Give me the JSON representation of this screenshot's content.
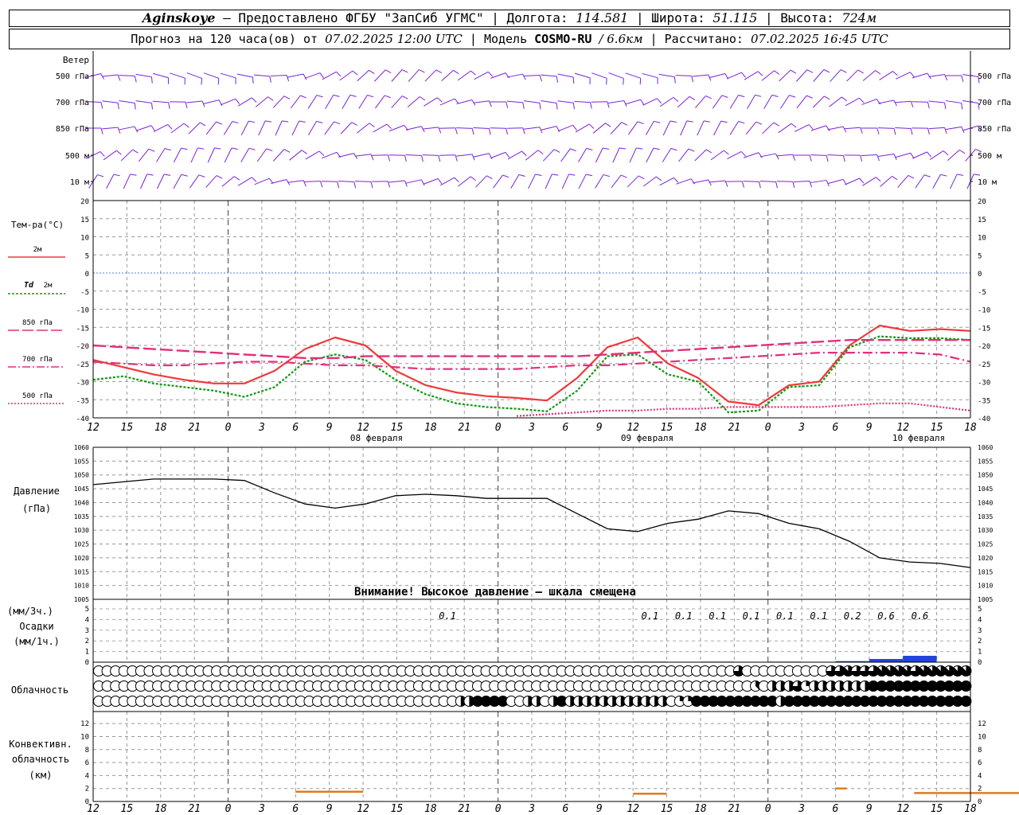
{
  "header": {
    "station": "Aginskoye",
    "provider": "– Предоставлено ФГБУ \"ЗапСиб УГМС\"",
    "lon_label": "Долгота:",
    "lon": "114.581",
    "lat_label": "Широта:",
    "lat": "51.115",
    "alt_label": "Высота:",
    "alt": "724м",
    "forecast_label": "Прогноз на 120 часа(ов) от",
    "forecast_start": "07.02.2025 12:00 UTC",
    "model_label": "Модель",
    "model": "COSMO-RU",
    "resolution": "/ 6.6км",
    "computed_label": "Рассчитано:",
    "computed": "07.02.2025 16:45 UTC"
  },
  "labels": {
    "wind_title": "Ветер",
    "wind_levels": [
      "500 гПа",
      "700 гПа",
      "850 гПа",
      "500 м",
      "10 м"
    ],
    "temp_title": "Тем-ра(°C)",
    "legend_2m": "2м",
    "legend_td": "Td",
    "legend_td_2m": "2м",
    "legend_850": "850 гПа",
    "legend_700": "700 гПа",
    "legend_500": "500 гПа",
    "pressure_title": "Давление",
    "pressure_unit": "(гПа)",
    "pressure_warning": "Внимание! Высокое давление – шкала смещена",
    "precip_unit3": "(мм/3ч.)",
    "precip_title": "Осадки",
    "precip_unit1": "(мм/1ч.)",
    "cloud_title": "Облачность",
    "conv_title1": "Конвективн.",
    "conv_title2": "облачность",
    "conv_unit": "(км)",
    "date_labels": [
      "08 февраля",
      "09 февраля",
      "10 февраля"
    ]
  },
  "chart_data": {
    "type": "line",
    "time_ticks": [
      "12",
      "15",
      "18",
      "21",
      "0",
      "3",
      "6",
      "9",
      "12",
      "15",
      "18",
      "21",
      "0",
      "3",
      "6",
      "9",
      "12",
      "15",
      "18",
      "21",
      "0",
      "3",
      "6",
      "9",
      "12",
      "15",
      "18"
    ],
    "temperature": {
      "ylim": [
        -40,
        20
      ],
      "yticks": [
        20,
        15,
        10,
        5,
        0,
        -5,
        -10,
        -15,
        -20,
        -25,
        -30,
        -35,
        -40
      ],
      "hours": [
        0,
        3,
        6,
        9,
        12,
        15,
        18,
        21,
        24,
        27,
        30,
        33,
        36,
        39,
        42,
        45,
        48,
        51,
        54,
        57,
        60,
        63,
        66,
        69,
        72,
        75,
        78
      ],
      "series": [
        {
          "name": "2м",
          "color": "#ee3a3a",
          "values": [
            -24,
            -26,
            -28,
            -29.5,
            -30.5,
            -30.5,
            -27,
            -21,
            -17.8,
            -20,
            -27,
            -31,
            -33,
            -34,
            -34.5,
            -35.2,
            -29,
            -20.5,
            -17.8,
            -25,
            -29,
            -35.5,
            -36.5,
            -31,
            -30,
            -20,
            -14.5,
            -16,
            -15.5,
            -16
          ]
        },
        {
          "name": "Td 2м",
          "color": "#119911",
          "values": [
            -29.5,
            -28.5,
            -30.5,
            -31.5,
            -32.5,
            -34.2,
            -31.5,
            -24.5,
            -22.5,
            -24,
            -29.5,
            -33.5,
            -36,
            -37,
            -37.5,
            -38.2,
            -32.5,
            -23,
            -22.5,
            -28,
            -30,
            -38.5,
            -38,
            -31.5,
            -31,
            -20.5,
            -17.5,
            -18,
            -18,
            -18.5
          ]
        },
        {
          "name": "850 гПа",
          "color": "#e0307a",
          "values": [
            -20,
            -20.5,
            -21,
            -21.5,
            -22,
            -22.5,
            -23,
            -23.5,
            -23.5,
            -23,
            -23,
            -23,
            -23,
            -23,
            -23,
            -23,
            -23,
            -22.5,
            -22,
            -21.5,
            -21,
            -20.5,
            -20,
            -19.5,
            -19,
            -18.5,
            -18.5,
            -18.5,
            -18.5,
            -18.5
          ]
        },
        {
          "name": "700 гПа",
          "color": "#e0307a",
          "values": [
            -24.5,
            -25,
            -25.5,
            -25.5,
            -25,
            -24.5,
            -24.5,
            -25,
            -25.5,
            -25.5,
            -26,
            -26.5,
            -26.5,
            -26.5,
            -26.5,
            -26,
            -25.5,
            -25.5,
            -25,
            -24.5,
            -24,
            -23.5,
            -23,
            -22.5,
            -22,
            -22,
            -22,
            -22,
            -22.5,
            -24.5
          ]
        },
        {
          "name": "500 гПа",
          "color": "#e0307a",
          "values": [
            null,
            null,
            null,
            null,
            null,
            null,
            null,
            null,
            null,
            null,
            null,
            null,
            null,
            null,
            -39.5,
            -39,
            -38.5,
            -38,
            -38,
            -37.5,
            -37.5,
            -37,
            -37,
            -37,
            -37,
            -36.5,
            -36,
            -36,
            -37,
            -38
          ]
        }
      ]
    },
    "pressure": {
      "ylim": [
        1005,
        1060
      ],
      "yticks": [
        1060,
        1055,
        1050,
        1045,
        1040,
        1035,
        1030,
        1025,
        1020,
        1015,
        1010,
        1005
      ],
      "values": [
        1046.5,
        1047.5,
        1048.5,
        1048.5,
        1048.5,
        1048,
        1043.5,
        1039.5,
        1038,
        1039.5,
        1042.5,
        1043,
        1042.5,
        1041.5,
        1041.5,
        1041.5,
        1036,
        1030.5,
        1029.5,
        1032.5,
        1034,
        1037,
        1036,
        1032.5,
        1030.5,
        1026,
        1020,
        1018.5,
        1018,
        1016.5
      ]
    },
    "precipitation": {
      "ylim": [
        0,
        5
      ],
      "yticks": [
        5,
        4,
        3,
        2,
        1,
        0
      ],
      "labels_3h": [
        {
          "hour": 43.5,
          "text": "0.1"
        },
        {
          "hour": 61.5,
          "text": "0.1"
        },
        {
          "hour": 64.5,
          "text": "0.1"
        },
        {
          "hour": 67.5,
          "text": "0.1"
        },
        {
          "hour": 70.5,
          "text": "0.1"
        },
        {
          "hour": 73.5,
          "text": "0.1"
        },
        {
          "hour": 76.5,
          "text": "0.1"
        },
        {
          "hour": 79.5,
          "text": "0.2"
        },
        {
          "hour": 82.5,
          "text": "0.6"
        },
        {
          "hour": 85.5,
          "text": "0.6"
        }
      ],
      "hourly": [
        {
          "hour": 42,
          "value": 0.05
        },
        {
          "hour": 60,
          "value": 0.05
        },
        {
          "hour": 66,
          "value": 0.05
        },
        {
          "hour": 72,
          "value": 0.05
        },
        {
          "hour": 78,
          "value": 0.1
        },
        {
          "hour": 81,
          "value": 0.3
        },
        {
          "hour": 84,
          "value": 0.6
        }
      ]
    },
    "cloud_cover_octas": {
      "upper": [
        0,
        0,
        0,
        0,
        0,
        0,
        0,
        0,
        0,
        0,
        0,
        0,
        0,
        0,
        0,
        0,
        0,
        0,
        0,
        0,
        0,
        0,
        0,
        0,
        0,
        0,
        0,
        0,
        0,
        0,
        0,
        0,
        0,
        0,
        0,
        0,
        0,
        0,
        0,
        0,
        0,
        0,
        0,
        0,
        0,
        0,
        0,
        0,
        0,
        0,
        0,
        0,
        0,
        0,
        0,
        0,
        0,
        0,
        0,
        0,
        0,
        0,
        0,
        0,
        0,
        0,
        0,
        0,
        0,
        0,
        0,
        0,
        0,
        0,
        0,
        0,
        6,
        0,
        0,
        0,
        0,
        0,
        0,
        0,
        0,
        0,
        0,
        6,
        6,
        7,
        6,
        6,
        6,
        7,
        7,
        7,
        7,
        6,
        7,
        7,
        7,
        7,
        7,
        7,
        7
      ],
      "middle": [
        0,
        0,
        0,
        0,
        0,
        0,
        0,
        0,
        0,
        0,
        0,
        0,
        0,
        0,
        0,
        0,
        0,
        0,
        0,
        0,
        0,
        0,
        0,
        0,
        0,
        0,
        0,
        0,
        0,
        0,
        0,
        0,
        0,
        0,
        0,
        0,
        0,
        0,
        0,
        0,
        0,
        0,
        0,
        0,
        0,
        0,
        0,
        0,
        0,
        0,
        0,
        0,
        0,
        0,
        0,
        0,
        0,
        0,
        0,
        0,
        0,
        0,
        0,
        0,
        0,
        0,
        0,
        0,
        0,
        0,
        0,
        0,
        0,
        0,
        0,
        0,
        0,
        0,
        3,
        0,
        4,
        4,
        4,
        6,
        2,
        4,
        4,
        4,
        4,
        4,
        4,
        4,
        8,
        8,
        8,
        8,
        8,
        8,
        8,
        8,
        8,
        8,
        8,
        8,
        8
      ],
      "lower": [
        0,
        0,
        0,
        0,
        0,
        0,
        0,
        0,
        0,
        0,
        0,
        0,
        0,
        0,
        0,
        0,
        0,
        0,
        0,
        0,
        0,
        0,
        0,
        0,
        0,
        0,
        0,
        0,
        0,
        0,
        0,
        0,
        0,
        0,
        0,
        0,
        0,
        0,
        0,
        0,
        0,
        0,
        0,
        4,
        4,
        8,
        8,
        8,
        8,
        0,
        0,
        4,
        4,
        0,
        4,
        8,
        4,
        4,
        4,
        4,
        4,
        4,
        4,
        4,
        4,
        4,
        4,
        4,
        0,
        2,
        2,
        8,
        8,
        8,
        8,
        8,
        8,
        8,
        8,
        8,
        8,
        4,
        8,
        8,
        8,
        8,
        8,
        8,
        8,
        8,
        8,
        8,
        8,
        8,
        8,
        8,
        8,
        8,
        8,
        8,
        8,
        8,
        8,
        8,
        8
      ]
    },
    "convective_cloud_km": {
      "ylim": [
        0,
        13
      ],
      "yticks": [
        12,
        10,
        8,
        6,
        4,
        2,
        0
      ],
      "segments": [
        {
          "from": 18,
          "to": 24,
          "value": 1.5
        },
        {
          "from": 48,
          "to": 51,
          "value": 1.2
        },
        {
          "from": 66,
          "to": 67,
          "value": 2.0
        },
        {
          "from": 73,
          "to": 90,
          "value": 1.3
        }
      ]
    }
  }
}
